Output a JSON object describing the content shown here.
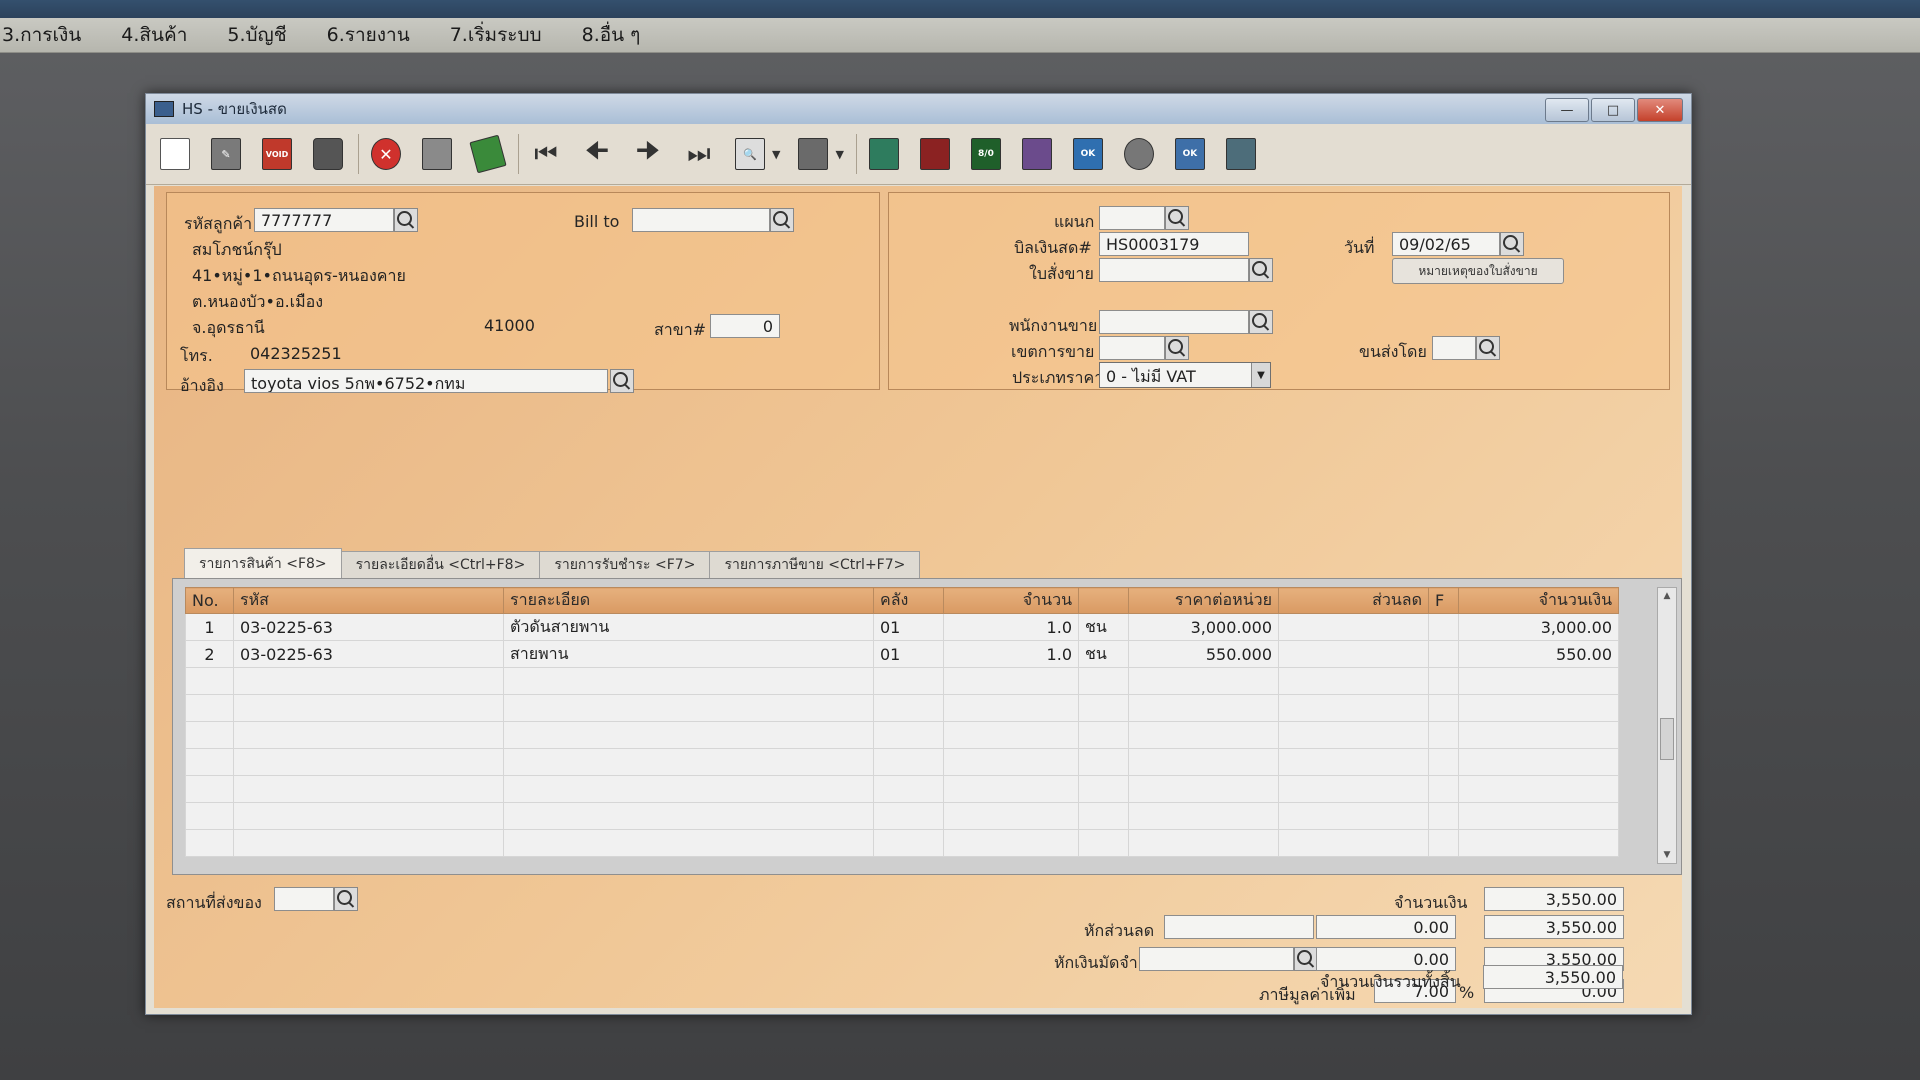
{
  "menu": [
    "3.การเงิน",
    "4.สินค้า",
    "5.บัญชี",
    "6.รายงาน",
    "7.เริ่มระบบ",
    "8.อื่น ๆ"
  ],
  "window": {
    "title": "HS - ขายเงินสด"
  },
  "toolbar": {
    "buttons": [
      {
        "name": "new-doc-icon"
      },
      {
        "name": "edit-icon"
      },
      {
        "name": "void-icon",
        "text": "VOID"
      },
      {
        "name": "delete-trash-icon"
      },
      {
        "name": "cancel-x-icon"
      },
      {
        "name": "save-icon"
      },
      {
        "name": "stack-icon"
      },
      {
        "name": "first-record-icon"
      },
      {
        "name": "prev-record-icon"
      },
      {
        "name": "next-record-icon"
      },
      {
        "name": "last-record-icon"
      },
      {
        "name": "preview-icon"
      },
      {
        "name": "print-icon"
      },
      {
        "name": "calc-icon"
      },
      {
        "name": "card-icon"
      },
      {
        "name": "count-icon",
        "text": "8/0"
      },
      {
        "name": "cashier-icon"
      },
      {
        "name": "user-ok-icon",
        "text": "OK"
      },
      {
        "name": "settings-icon"
      },
      {
        "name": "door-ok-icon",
        "text": "OK"
      },
      {
        "name": "network-icon"
      }
    ]
  },
  "customer": {
    "code_label": "รหัสลูกค้า",
    "code_value": "7777777",
    "bill_to_label": "Bill to",
    "bill_to_value": "",
    "name": "สมโภชน์กรุ๊ป",
    "address1": "41•หมู่•1•ถนนอุดร-หนองคาย",
    "address2": "ต.หนองบัว•อ.เมือง",
    "province": "จ.อุดรธานี",
    "postcode": "41000",
    "branch_label": "สาขา#",
    "branch_value": "0",
    "phone_label": "โทร.",
    "phone_value": "042325251",
    "ref_label": "อ้างอิง",
    "ref_value": "toyota vios 5กพ•6752•กทม"
  },
  "doc": {
    "dept_label": "แผนก",
    "dept_value": "",
    "bill_label": "บิลเงินสด#",
    "bill_value": "HS0003179",
    "date_label": "วันที่",
    "date_value": "09/02/65",
    "order_label": "ใบสั่งขาย",
    "order_value": "",
    "order_note_button": "หมายเหตุของใบสั่งขาย",
    "sales_label": "พนักงานขาย",
    "sales_value": "",
    "area_label": "เขตการขาย",
    "area_value": "",
    "ship_label": "ขนส่งโดย",
    "ship_value": "",
    "price_type_label": "ประเภทราคา",
    "price_type_value": "0 - ไม่มี VAT"
  },
  "tabs": [
    "รายการสินค้า <F8>",
    "รายละเอียดอื่น <Ctrl+F8>",
    "รายการรับชำระ <F7>",
    "รายการภาษีขาย <Ctrl+F7>"
  ],
  "grid": {
    "headers": [
      "No.",
      "รหัส",
      "รายละเอียด",
      "คลัง",
      "จำนวน",
      "",
      "ราคาต่อหน่วย",
      "ส่วนลด",
      "F",
      "จำนวนเงิน"
    ],
    "rows": [
      [
        "1",
        "03-0225-63",
        "ตัวดันสายพาน",
        "01",
        "1.0",
        "ชน",
        "3,000.000",
        "",
        "",
        "3,000.00"
      ],
      [
        "2",
        "03-0225-63",
        "สายพาน",
        "01",
        "1.0",
        "ชน",
        "550.000",
        "",
        "",
        "550.00"
      ]
    ]
  },
  "footer": {
    "place_label": "สถานที่ส่งของ",
    "place_value": "",
    "amount_label": "จำนวนเงิน",
    "amount_value": "3,550.00",
    "discount_label": "หักส่วนลด",
    "discount_input": "",
    "discount_value": "0.00",
    "discount_total": "3,550.00",
    "deposit_label": "หักเงินมัดจำ",
    "deposit_input": "",
    "deposit_value": "0.00",
    "deposit_total": "3,550.00",
    "vat_label": "ภาษีมูลค่าเพิ่ม",
    "vat_rate": "7.00",
    "vat_pct": "%",
    "vat_value": "0.00",
    "grand_label": "จำนวนเงินรวมทั้งสิ้น",
    "grand_value": "3,550.00"
  }
}
